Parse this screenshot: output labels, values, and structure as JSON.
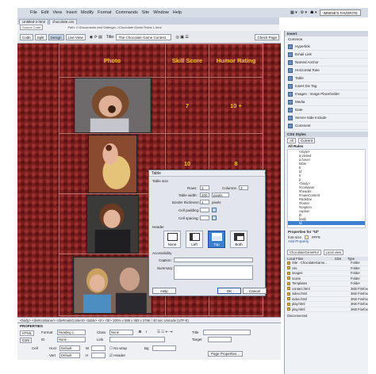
{
  "app": {
    "logo": "Dw",
    "menus": [
      "File",
      "Edit",
      "View",
      "Insert",
      "Modify",
      "Format",
      "Commands",
      "Site",
      "Window",
      "Help"
    ],
    "workspace": "IMMINE'S FAVORITE"
  },
  "tabs": [
    "Untitled-2.html",
    "chocolate.css"
  ],
  "source_code": "Source Code",
  "path_text": "Path: C:\\Documents and Settings\\...\\Chocolate Game Rules 1.html",
  "toolbar": {
    "code": "Code",
    "split": "Split",
    "design": "Design",
    "live_view": "Live View",
    "title_label": "Title:",
    "title_value": "The Chocolate Game Contest",
    "check_page": "Check Page"
  },
  "table": {
    "headers": [
      "Photo",
      "Skill Score",
      "Humor Rating"
    ],
    "rows": [
      {
        "skill": "7",
        "humor": "10 +"
      },
      {
        "skill": "10",
        "humor": "8"
      },
      {
        "skill": "",
        "humor": ""
      },
      {
        "skill": "",
        "humor": ""
      }
    ]
  },
  "dialog": {
    "title": "Table",
    "section_size": "Table size",
    "rows_label": "Rows:",
    "rows_value": "3",
    "columns_label": "Columns:",
    "columns_value": "3",
    "width_label": "Table width:",
    "width_value": "200",
    "width_unit": "pixels",
    "border_label": "Border thickness:",
    "border_value": "1",
    "border_unit": "pixels",
    "padding_label": "Cell padding:",
    "spacing_label": "Cell spacing:",
    "header_label": "Header",
    "header_options": [
      "None",
      "Left",
      "Top",
      "Both"
    ],
    "accessibility": "Accessibility",
    "caption_label": "Caption:",
    "summary_label": "Summary:",
    "help": "Help",
    "ok": "OK",
    "cancel": "Cancel"
  },
  "insert_panel": {
    "tab": "Insert",
    "category": "Common",
    "items": [
      "Hyperlink",
      "Email Link",
      "Named Anchor",
      "Horizontal Rule",
      "Table",
      "Insert Div Tag",
      "Images : Image Placeholder",
      "Media",
      "Date",
      "Server-Side Include",
      "Comment"
    ]
  },
  "css_panel": {
    "tab": "CSS Styles",
    "current": "Current",
    "all": "All",
    "all_rules": "All Rules",
    "rules": [
      "<style>",
      "a:visited",
      "a:hover",
      "table",
      "tr",
      "td",
      "tr",
      "p",
      "<body>",
      "#container",
      "#header",
      "#mainContent",
      "#sidebar",
      "#footer",
      "#caption",
      "caption",
      "th",
      "body",
      "td"
    ],
    "properties_label": "Properties for \"td\"",
    "prop": "font-size",
    "prop_value": "#FF9",
    "add_property": "Add Property"
  },
  "files_panel": {
    "site": "ChocolateGameRul",
    "view": "Local view",
    "header_local": "Local Files",
    "header_size": "Size",
    "header_type": "Type",
    "items": [
      {
        "name": "Site - ChocolateGame...",
        "type": "Folder"
      },
      {
        "name": "css",
        "type": "Folder"
      },
      {
        "name": "images",
        "type": "Folder"
      },
      {
        "name": "scans",
        "type": "Folder"
      },
      {
        "name": "Templates",
        "type": "Folder"
      },
      {
        "name": "contact.html",
        "type": "3KB Firefox"
      },
      {
        "name": "video.html",
        "type": "3KB Firefox"
      },
      {
        "name": "index.html",
        "type": "3KB Firefox"
      },
      {
        "name": "play.html",
        "type": "3KB Firefox"
      },
      {
        "name": "play.html",
        "type": "3KB Firefox"
      }
    ],
    "status": "Disconnected"
  },
  "statusbar": "<body> <div#container> <div#mainContent> <table> <tr> <th>   100% v  588 x 383 v  276K / 40 sec  Unicode (UTF-8)",
  "properties": {
    "title": "PROPERTIES",
    "html": "HTML",
    "css": "CSS",
    "format_label": "Format",
    "format_value": "Heading 1",
    "class_label": "Class",
    "class_value": "None",
    "id_label": "ID",
    "id_value": "None",
    "link_label": "Link",
    "title_label": "Title",
    "target_label": "Target",
    "cell_label": "Cell",
    "horz_label": "Horz",
    "horz_value": "Default",
    "vert_label": "Vert",
    "vert_value": "Default",
    "w_label": "W",
    "h_label": "H",
    "no_wrap": "No wrap",
    "header_label": "Header",
    "bg_label": "Bg",
    "page_properties": "Page Properties..."
  }
}
